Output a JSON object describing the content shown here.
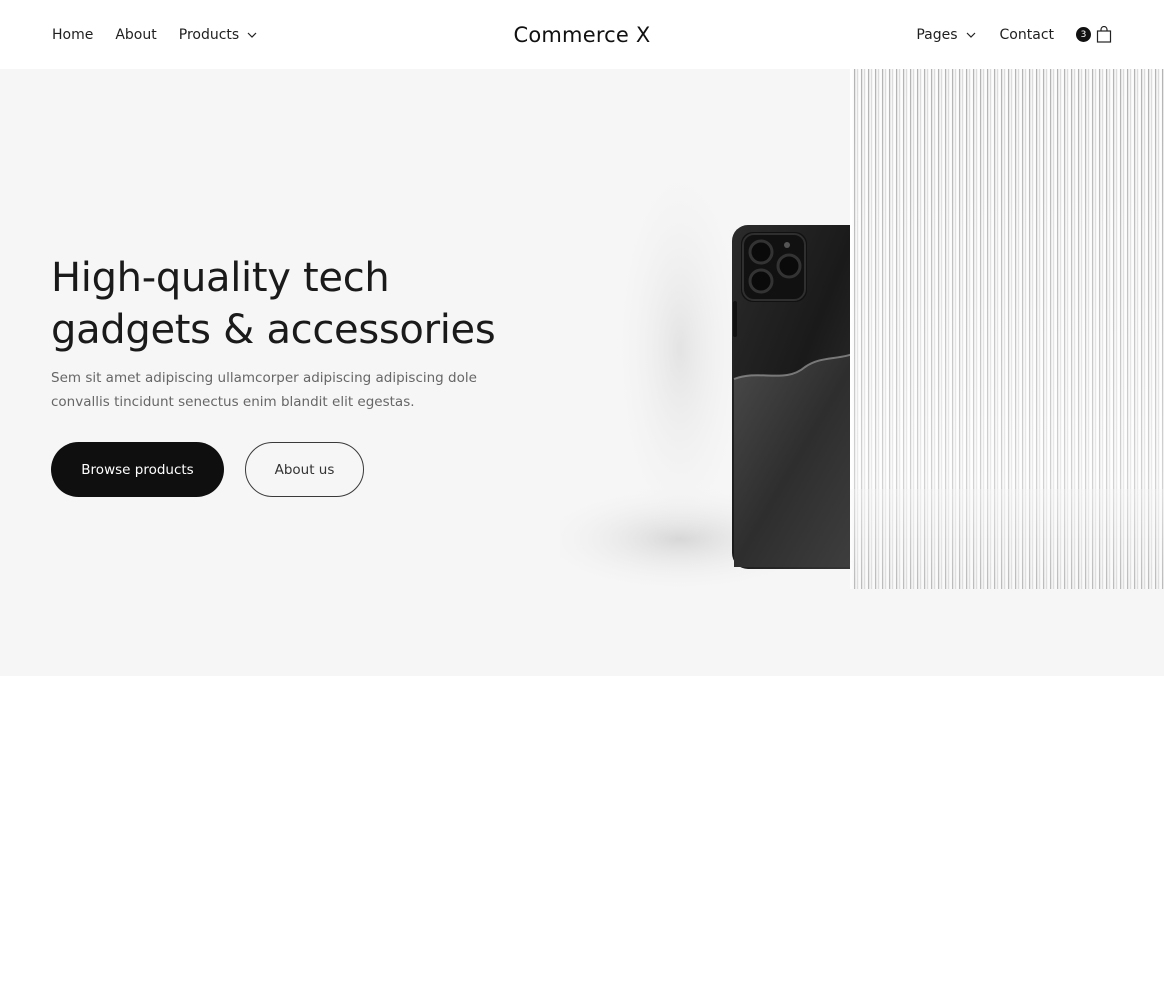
{
  "header": {
    "nav_left": [
      {
        "label": "Home"
      },
      {
        "label": "About"
      },
      {
        "label": "Products",
        "icon": "chevron-down-icon"
      }
    ],
    "logo": "Commerce X",
    "nav_right": [
      {
        "label": "Pages",
        "icon": "chevron-down-icon"
      },
      {
        "label": "Contact"
      }
    ],
    "cart": {
      "count": "3",
      "icon": "shopping-bag-icon"
    }
  },
  "hero": {
    "title_line1": "High-quality tech",
    "title_line2": "gadgets & accessories",
    "text": "Sem sit amet adipiscing ullamcorper adipiscing adipiscing dole convallis tincidunt senectus enim blandit elit egestas.",
    "primary_button": "Browse products",
    "secondary_button": "About us",
    "image": "black-phone-behind-ribbed-glass"
  },
  "colors": {
    "hero_background": "#f6f6f6",
    "primary_button": "#0f0f0f",
    "text": "#1a1a1a",
    "muted_text": "#666666"
  }
}
